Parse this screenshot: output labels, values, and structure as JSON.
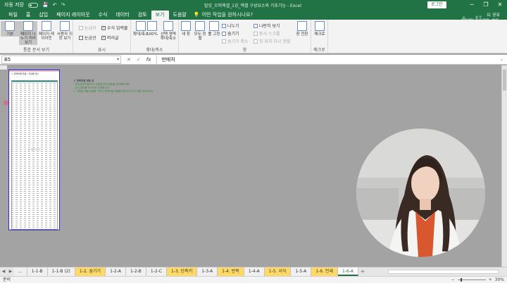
{
  "titlebar": {
    "autosave_label": "자동 저장",
    "title": "탈잉_오피엑셀_1강_엑셀 구성요소와 기초기능 - Excel",
    "login": "로그인",
    "min": "─",
    "max": "❐",
    "close": "✕",
    "save_icon": "💾",
    "undo_icon": "↶",
    "redo_icon": "↷"
  },
  "tabs": {
    "items": [
      "파일",
      "홈",
      "삽입",
      "페이지 레이아웃",
      "수식",
      "데이터",
      "검토",
      "보기",
      "도움말"
    ],
    "active_index": 7,
    "tell_me": "어떤 작업을 원하시나요?",
    "share": "公 공유",
    "brand": "taling"
  },
  "ribbon": {
    "groups": {
      "workbook_views": {
        "label": "통합 문서 보기",
        "buttons": [
          "기본",
          "페이지 나누기 미리 보기",
          "페이지 레이아웃",
          "사용자 지정 보기"
        ]
      },
      "show": {
        "label": "표시",
        "ruler": "눈금자",
        "formula_bar": "수식 입력줄",
        "gridlines": "눈금선",
        "headings": "머리글"
      },
      "zoom": {
        "label": "확대/축소",
        "buttons": [
          "확대/축소",
          "100%",
          "선택 영역 확대/축소"
        ]
      },
      "window": {
        "label": "창",
        "new_window": "새 창",
        "arrange_all": "모두 정렬",
        "freeze_panes": "틀 고정",
        "split": "나누기",
        "hide": "숨기기",
        "unhide": "숨기기 취소",
        "side_by_side": "나란히 보기",
        "sync_scroll": "동시 스크롤",
        "reset_position": "창 위치 다시 정렬",
        "switch_windows": "창 전환"
      },
      "macros": {
        "label": "매크로",
        "button": "매크로"
      }
    }
  },
  "formula_bar": {
    "name_box": "B5",
    "cancel": "✕",
    "enter": "✓",
    "fx": "fx",
    "content": "판매처"
  },
  "sheet": {
    "page_title": "1. 판매처별 현황 / 지점별 매출",
    "watermark": "1 페이지",
    "notes": [
      "1. 판매처별 현황 표",
      "- 판매 데이터를 보고 지점별 판매 현황을 분석해보세요",
      "- 분석 결과를 보고서로 작성합니다",
      "2. 지점별 매출 합계를 구하고 판매처별 매출을 확인하여 보고서를 작성하세요"
    ]
  },
  "sheet_tabs": {
    "items": [
      {
        "label": "...",
        "color": "none"
      },
      {
        "label": "1-1-B",
        "color": "none"
      },
      {
        "label": "1-1-B (2)",
        "color": "none"
      },
      {
        "label": "1-2. 숨기기",
        "color": "yellow"
      },
      {
        "label": "1-2-A",
        "color": "none"
      },
      {
        "label": "1-2-B",
        "color": "none"
      },
      {
        "label": "1-2-C",
        "color": "none"
      },
      {
        "label": "1-3. 단축키",
        "color": "yellow"
      },
      {
        "label": "1-3-A",
        "color": "none"
      },
      {
        "label": "1-4. 반복",
        "color": "yellow"
      },
      {
        "label": "1-4-A",
        "color": "none"
      },
      {
        "label": "1-5. 서식",
        "color": "yellow"
      },
      {
        "label": "1-5-A",
        "color": "none"
      },
      {
        "label": "1-6. 인쇄",
        "color": "yellow"
      },
      {
        "label": "1-6-A",
        "color": "active"
      }
    ],
    "add": "+"
  },
  "status": {
    "ready": "준비",
    "zoom_out": "−",
    "zoom_in": "+",
    "zoom": "30%"
  },
  "colors": {
    "excel_green": "#217346",
    "page_break_border": "#2b2bd9",
    "yellow_tab": "#ffd966"
  }
}
